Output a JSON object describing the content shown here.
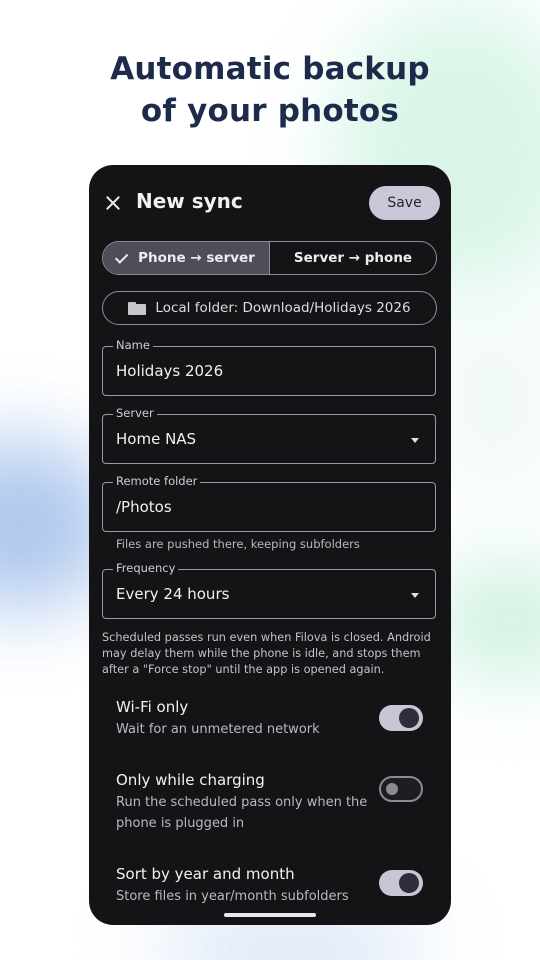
{
  "headline": {
    "line1": "Automatic backup",
    "line2": "of your photos"
  },
  "app": {
    "title": "New sync",
    "save_label": "Save",
    "direction": {
      "options": [
        "Phone → server",
        "Server → phone"
      ],
      "selected": "Phone → server"
    },
    "local_folder_label": "Local folder: Download/Holidays 2026",
    "fields": {
      "name": {
        "label": "Name",
        "value": "Holidays 2026"
      },
      "server": {
        "label": "Server",
        "value": "Home NAS"
      },
      "remote_folder": {
        "label": "Remote folder",
        "value": "/Photos",
        "helper": "Files are pushed there, keeping subfolders"
      },
      "frequency": {
        "label": "Frequency",
        "value": "Every 24 hours"
      }
    },
    "note": "Scheduled passes run even when Filova is closed. Android may delay them while the phone is idle, and stops them after a \"Force stop\" until the app is opened again.",
    "settings": [
      {
        "title": "Wi-Fi only",
        "description": "Wait for an unmetered network",
        "enabled": true
      },
      {
        "title": "Only while charging",
        "description": "Run the scheduled pass only when the phone is plugged in",
        "enabled": false
      },
      {
        "title": "Sort by year and month",
        "description": "Store files in year/month subfolders",
        "enabled": true
      }
    ]
  },
  "icons": {
    "close": "close-icon",
    "check": "check-icon",
    "folder": "folder-icon",
    "dropdown": "chevron-down-icon"
  },
  "colors": {
    "headline": "#1d2a4a",
    "phone_background": "#141416",
    "accent_light": "#c9c8d8"
  }
}
